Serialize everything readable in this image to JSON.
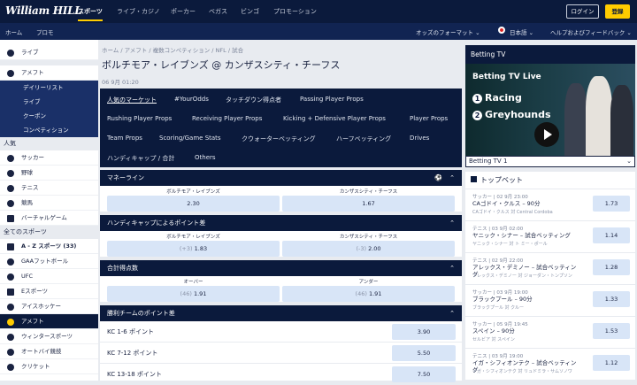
{
  "brand": "William HILL",
  "topnav": [
    "スポーツ",
    "ライブ・カジノ",
    "ポーカー",
    "ベガス",
    "ビンゴ",
    "プロモーション"
  ],
  "login": "ログイン",
  "register": "登録",
  "subnav": {
    "home": "ホーム",
    "promo": "プロモ",
    "odds_format": "オッズのフォーマット ⌄",
    "lang": "日本語 ⌄",
    "help": "ヘルプおよびフィードバック ⌄"
  },
  "sidebar": {
    "live": "ライブ",
    "amefuto": "アメフト",
    "amefuto_sub": [
      "デイリーリスト",
      "ライブ",
      "クーポン",
      "コンペティション"
    ],
    "popular": "人気",
    "popular_items": [
      "サッカー",
      "野球",
      "テニス",
      "競馬",
      "バーチャルゲーム"
    ],
    "all": "全てのスポーツ",
    "all_items": [
      "A - Z スポーツ (33)",
      "GAAフットボール",
      "UFC",
      "Eスポーツ",
      "アイスホッケー",
      "アメフト",
      "ウィンタースポーツ",
      "オートバイ競技",
      "クリケット"
    ]
  },
  "breadcrumb": "ホーム / アメフト / 複数コンペティション / NFL / 試合",
  "match_title": "ボルチモア・レイブンズ @ カンザスシティ・チーフス",
  "match_date": "06 9月 01:20",
  "tabs": [
    [
      "人気のマーケット",
      "#YourOdds",
      "タッチダウン得点者",
      "Passing Player Props"
    ],
    [
      "Rushing Player Props",
      "Receiving Player Props",
      "Kicking + Defensive Player Props",
      "Player Props"
    ],
    [
      "Team Props",
      "Scoring/Game Stats",
      "クウォーターベッティング",
      "ハーフベッティング",
      "Drives"
    ],
    [
      "ハンディキャップ / 合計",
      "Others"
    ]
  ],
  "markets": {
    "moneyline": {
      "title": "マネーライン",
      "home": "ボルチモア・レイブンズ",
      "away": "カンザスシティ・チーフス",
      "home_odd": "2.30",
      "away_odd": "1.67"
    },
    "handicap": {
      "title": "ハンディキャップによるポイント差",
      "home": "ボルチモア・レイブンズ",
      "away": "カンザスシティ・チーフス",
      "home_h": "(+3)",
      "home_odd": "1.83",
      "away_h": "(-3)",
      "away_odd": "2.00"
    },
    "total": {
      "title": "合計得点数",
      "over": "オーバー",
      "under": "アンダー",
      "over_h": "(46)",
      "over_odd": "1.91",
      "under_h": "(46)",
      "under_odd": "1.91"
    },
    "margin": {
      "title": "勝利チームのポイント差",
      "rows": [
        {
          "label": "KC 1-6 ポイント",
          "odd": "3.90"
        },
        {
          "label": "KC 7-12 ポイント",
          "odd": "5.50"
        },
        {
          "label": "KC 13-18 ポイント",
          "odd": "7.50"
        }
      ]
    }
  },
  "betting_tv": {
    "header": "Betting TV",
    "live": "Betting TV Live",
    "racing": "Racing",
    "greyhounds": "Greyhounds",
    "select": "Betting TV 1"
  },
  "top_bets": {
    "title": "トップベット",
    "items": [
      {
        "meta": "サッカー | 02 9月 23:00",
        "name": "CAゴドイ・クルス – 90分",
        "sub": "CAゴドイ・クルス 対 Central Cordoba",
        "odd": "1.73"
      },
      {
        "meta": "テニス | 03 9月 02:00",
        "name": "ヤニック・シナー – 試合ベッティング",
        "sub": "ヤニック・シナー 対 ト ミー・ポール",
        "odd": "1.14"
      },
      {
        "meta": "テニス | 02 9月 22:00",
        "name": "アレックス・デミノー – 試合ベッティング",
        "sub": "アレックス・デミノー 対 ジョーダン・トンプソン",
        "odd": "1.28"
      },
      {
        "meta": "サッカー | 03 9月 19:00",
        "name": "ブラックプール – 90分",
        "sub": "ブラックプール 対 クルー",
        "odd": "1.33"
      },
      {
        "meta": "サッカー | 05 9月 19:45",
        "name": "スペイン – 90分",
        "sub": "セルビア 対 スペイン",
        "odd": "1.53"
      },
      {
        "meta": "テニス | 03 9月 19:00",
        "name": "イガ・シフィオンテク – 試合ベッティング",
        "sub": "イガ・シフィオンテク 対 リュドミラ・サムソノワ",
        "odd": "1.12"
      }
    ]
  }
}
